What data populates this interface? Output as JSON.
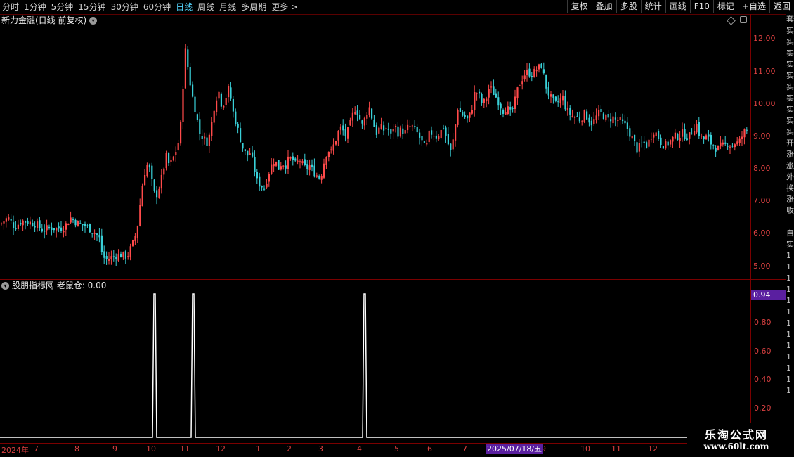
{
  "toolbar": {
    "periods": [
      "分时",
      "1分钟",
      "5分钟",
      "15分钟",
      "30分钟",
      "60分钟",
      "日线",
      "周线",
      "月线",
      "多周期",
      "更多 >"
    ],
    "active_period": "日线",
    "buttons": [
      "复权",
      "叠加",
      "多股",
      "统计",
      "画线",
      "F10",
      "标记",
      "+自选",
      "返回"
    ]
  },
  "main_chart": {
    "title": "新力金融(日线 前复权)",
    "y_ticks": [
      "12.00",
      "11.00",
      "10.00",
      "9.00",
      "8.00",
      "7.00",
      "6.00",
      "5.00"
    ]
  },
  "indicator": {
    "title": "股朋指标网 老鼠仓: 0.00",
    "current_value": "0.94",
    "y_ticks": [
      "0.80",
      "0.60",
      "0.40",
      "0.20"
    ]
  },
  "date_axis": {
    "ticks": [
      "2024年",
      "7",
      "8",
      "9",
      "10",
      "11",
      "12",
      "1",
      "2",
      "3",
      "4",
      "5",
      "6",
      "7",
      "9",
      "10",
      "11",
      "12"
    ],
    "highlight": "2025/07/18/五"
  },
  "side_strip": {
    "chars": [
      "套",
      "实",
      "实",
      "实",
      "实",
      "实",
      "实",
      "实",
      "实",
      "实",
      "实",
      "开",
      "涨",
      "涨",
      "外",
      "换",
      "涨",
      "收",
      "",
      "自",
      "实",
      "1",
      "1",
      "1",
      "1",
      "1",
      "1",
      "1",
      "1",
      "1",
      "1",
      "1",
      "1",
      "1"
    ]
  },
  "watermark": {
    "line1": "乐淘公式网",
    "line2": "www.60lt.com"
  },
  "chart_data": {
    "type": "candlestick",
    "price_axis": {
      "min": 5.0,
      "max": 12.0
    },
    "up_color": "#ff4a4a",
    "down_color": "#39d0d8",
    "daily_close_path": [
      [
        0,
        6.3
      ],
      [
        10,
        6.5
      ],
      [
        20,
        6.2
      ],
      [
        30,
        6.4
      ],
      [
        40,
        6.35
      ],
      [
        50,
        6.3
      ],
      [
        60,
        6.1
      ],
      [
        70,
        6.2
      ],
      [
        80,
        6.15
      ],
      [
        90,
        6.2
      ],
      [
        100,
        6.5
      ],
      [
        110,
        6.3
      ],
      [
        120,
        6.25
      ],
      [
        130,
        6.1
      ],
      [
        140,
        5.9
      ],
      [
        145,
        5.3
      ],
      [
        150,
        5.2
      ],
      [
        160,
        5.3
      ],
      [
        170,
        5.35
      ],
      [
        180,
        5.3
      ],
      [
        190,
        5.8
      ],
      [
        196,
        6.4
      ],
      [
        200,
        7.3
      ],
      [
        205,
        7.9
      ],
      [
        210,
        8.2
      ],
      [
        215,
        7.6
      ],
      [
        220,
        7.1
      ],
      [
        225,
        7.4
      ],
      [
        230,
        7.8
      ],
      [
        235,
        8.4
      ],
      [
        240,
        8.1
      ],
      [
        245,
        8.3
      ],
      [
        250,
        8.6
      ],
      [
        255,
        9.0
      ],
      [
        260,
        10.8
      ],
      [
        263,
        11.7
      ],
      [
        267,
        11.0
      ],
      [
        272,
        10.3
      ],
      [
        278,
        9.7
      ],
      [
        283,
        9.1
      ],
      [
        290,
        8.9
      ],
      [
        295,
        8.8
      ],
      [
        300,
        9.4
      ],
      [
        305,
        10.1
      ],
      [
        310,
        10.4
      ],
      [
        315,
        9.9
      ],
      [
        320,
        10.2
      ],
      [
        325,
        10.5
      ],
      [
        330,
        9.8
      ],
      [
        335,
        9.4
      ],
      [
        340,
        9.0
      ],
      [
        345,
        8.6
      ],
      [
        350,
        8.4
      ],
      [
        355,
        8.5
      ],
      [
        360,
        8.1
      ],
      [
        365,
        7.6
      ],
      [
        370,
        7.5
      ],
      [
        375,
        7.4
      ],
      [
        380,
        7.8
      ],
      [
        385,
        8.1
      ],
      [
        390,
        8.3
      ],
      [
        395,
        8.0
      ],
      [
        400,
        8.2
      ],
      [
        405,
        8.1
      ],
      [
        410,
        8.3
      ],
      [
        415,
        8.3
      ],
      [
        420,
        8.1
      ],
      [
        425,
        8.3
      ],
      [
        430,
        8.1
      ],
      [
        435,
        8.0
      ],
      [
        440,
        8.1
      ],
      [
        445,
        7.9
      ],
      [
        450,
        7.8
      ],
      [
        455,
        7.7
      ],
      [
        460,
        8.2
      ],
      [
        465,
        8.6
      ],
      [
        470,
        8.5
      ],
      [
        475,
        8.8
      ],
      [
        480,
        9.1
      ],
      [
        485,
        9.3
      ],
      [
        490,
        9.0
      ],
      [
        495,
        9.2
      ],
      [
        500,
        9.6
      ],
      [
        505,
        9.9
      ],
      [
        510,
        9.6
      ],
      [
        515,
        9.3
      ],
      [
        520,
        9.7
      ],
      [
        525,
        9.9
      ],
      [
        530,
        9.4
      ],
      [
        535,
        9.1
      ],
      [
        540,
        9.3
      ],
      [
        545,
        9.2
      ],
      [
        550,
        9.3
      ],
      [
        555,
        9.0
      ],
      [
        560,
        9.4
      ],
      [
        565,
        9.1
      ],
      [
        570,
        9.2
      ],
      [
        575,
        9.1
      ],
      [
        580,
        9.3
      ],
      [
        585,
        9.3
      ],
      [
        590,
        9.2
      ],
      [
        595,
        9.0
      ],
      [
        600,
        8.8
      ],
      [
        605,
        8.6
      ],
      [
        610,
        9.1
      ],
      [
        615,
        9.1
      ],
      [
        620,
        9.0
      ],
      [
        625,
        9.1
      ],
      [
        630,
        9.3
      ],
      [
        635,
        8.9
      ],
      [
        640,
        8.5
      ],
      [
        645,
        9.0
      ],
      [
        650,
        9.9
      ],
      [
        655,
        9.7
      ],
      [
        660,
        9.6
      ],
      [
        665,
        9.5
      ],
      [
        670,
        9.8
      ],
      [
        675,
        10.4
      ],
      [
        680,
        10.3
      ],
      [
        685,
        10.0
      ],
      [
        690,
        10.1
      ],
      [
        695,
        10.5
      ],
      [
        700,
        10.4
      ],
      [
        705,
        10.2
      ],
      [
        710,
        10.0
      ],
      [
        715,
        9.8
      ],
      [
        720,
        9.9
      ],
      [
        725,
        9.7
      ],
      [
        730,
        9.9
      ],
      [
        735,
        10.4
      ],
      [
        740,
        10.7
      ],
      [
        745,
        10.9
      ],
      [
        750,
        11.0
      ],
      [
        755,
        10.9
      ],
      [
        760,
        11.0
      ],
      [
        765,
        11.1
      ],
      [
        770,
        11.2
      ],
      [
        775,
        10.6
      ],
      [
        780,
        10.3
      ],
      [
        785,
        10.1
      ],
      [
        790,
        10.0
      ],
      [
        795,
        10.1
      ],
      [
        800,
        10.2
      ],
      [
        805,
        9.8
      ],
      [
        810,
        9.7
      ],
      [
        815,
        9.6
      ],
      [
        820,
        9.6
      ],
      [
        825,
        9.5
      ],
      [
        830,
        9.7
      ],
      [
        835,
        9.6
      ],
      [
        840,
        9.4
      ],
      [
        845,
        9.5
      ],
      [
        850,
        9.7
      ],
      [
        855,
        9.7
      ],
      [
        860,
        9.6
      ],
      [
        865,
        9.5
      ],
      [
        870,
        9.6
      ],
      [
        875,
        9.5
      ],
      [
        880,
        9.5
      ],
      [
        885,
        9.4
      ],
      [
        890,
        9.3
      ],
      [
        895,
        9.1
      ],
      [
        900,
        8.9
      ],
      [
        905,
        8.6
      ],
      [
        910,
        8.7
      ],
      [
        915,
        8.8
      ],
      [
        920,
        8.7
      ],
      [
        925,
        9.0
      ],
      [
        930,
        9.2
      ],
      [
        935,
        9.0
      ],
      [
        940,
        8.8
      ],
      [
        945,
        8.7
      ],
      [
        950,
        8.8
      ],
      [
        955,
        8.9
      ],
      [
        960,
        9.0
      ],
      [
        965,
        9.0
      ],
      [
        970,
        9.1
      ],
      [
        975,
        9.0
      ],
      [
        980,
        9.0
      ],
      [
        985,
        9.2
      ],
      [
        990,
        9.4
      ],
      [
        995,
        9.0
      ],
      [
        1000,
        8.9
      ],
      [
        1005,
        9.0
      ],
      [
        1010,
        8.8
      ],
      [
        1015,
        8.7
      ],
      [
        1020,
        8.6
      ],
      [
        1025,
        8.7
      ],
      [
        1030,
        8.7
      ],
      [
        1035,
        8.8
      ],
      [
        1040,
        8.7
      ],
      [
        1045,
        8.8
      ],
      [
        1050,
        8.8
      ],
      [
        1055,
        9.0
      ],
      [
        1060,
        9.2
      ]
    ],
    "indicator_series": {
      "name": "老鼠仓",
      "axis": {
        "min": 0.0,
        "max": 1.0
      },
      "spikes_at_date_index": [
        10,
        11,
        15
      ]
    }
  }
}
